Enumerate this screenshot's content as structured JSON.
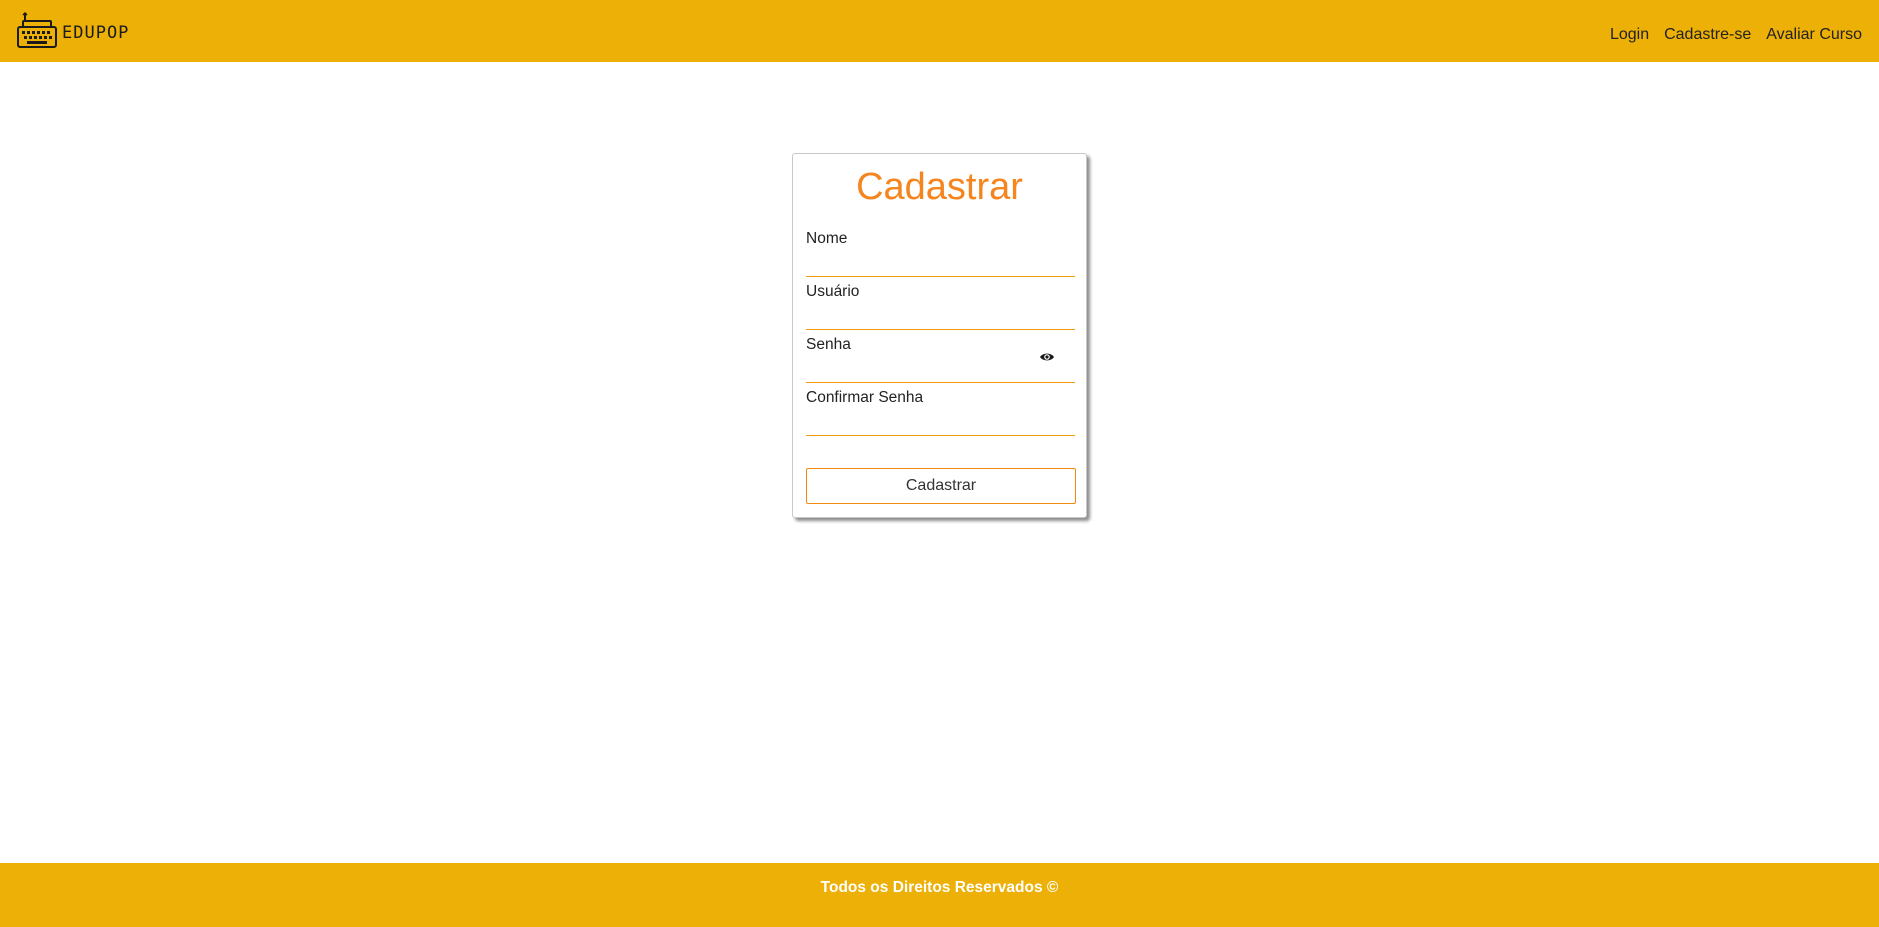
{
  "header": {
    "brand": "EDUPOP",
    "logo_icon": "typewriter-icon",
    "nav": [
      {
        "label": "Login"
      },
      {
        "label": "Cadastre-se"
      },
      {
        "label": "Avaliar Curso"
      }
    ]
  },
  "form": {
    "title": "Cadastrar",
    "fields": [
      {
        "label": "Nome",
        "value": ""
      },
      {
        "label": "Usuário",
        "value": ""
      },
      {
        "label": "Senha",
        "value": "",
        "icon": "eye-icon"
      },
      {
        "label": "Confirmar Senha",
        "value": ""
      }
    ],
    "submit_label": "Cadastrar"
  },
  "footer": {
    "text": "Todos os Direitos Reservados ©"
  },
  "colors": {
    "header_bg": "#edb006",
    "title": "#f4851f",
    "accent": "#f08a10",
    "footer_text": "#ffffff"
  }
}
